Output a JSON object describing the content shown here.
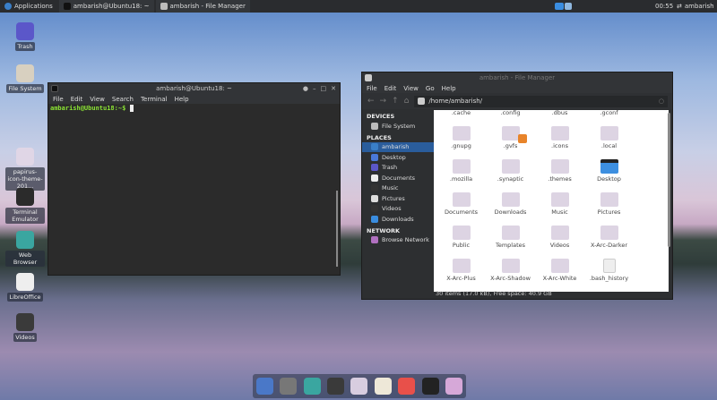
{
  "topbar": {
    "applications": "Applications",
    "windows": [
      "ambarish@Ubuntu18: ~",
      "ambarish - File Manager"
    ],
    "clock": "00:55",
    "user": "ambarish"
  },
  "desktop_icons": [
    {
      "label": "Trash",
      "color": "#5b57c9"
    },
    {
      "label": "File System",
      "color": "#d8d0c0"
    },
    {
      "label": "papirus-icon-theme-201...",
      "color": "#e0d6e6"
    },
    {
      "label": "Terminal Emulator",
      "color": "#2b2b2b"
    },
    {
      "label": "Web Browser",
      "color": "#3aa6a0"
    },
    {
      "label": "LibreOffice",
      "color": "#eeeeee"
    },
    {
      "label": "Videos",
      "color": "#3a3a3a"
    }
  ],
  "terminal": {
    "title": "ambarish@Ubuntu18: ~",
    "menu": [
      "File",
      "Edit",
      "View",
      "Search",
      "Terminal",
      "Help"
    ],
    "prompt": "ambarish@Ubuntu18:~$"
  },
  "file_manager": {
    "title": "ambarish - File Manager",
    "menu": [
      "File",
      "Edit",
      "View",
      "Go",
      "Help"
    ],
    "path": "/home/ambarish/",
    "sidebar": [
      {
        "header": "DEVICES",
        "items": [
          "File System"
        ]
      },
      {
        "header": "PLACES",
        "items": [
          "ambarish",
          "Desktop",
          "Trash",
          "Documents",
          "Music",
          "Pictures",
          "Videos",
          "Downloads"
        ]
      },
      {
        "header": "NETWORK",
        "items": [
          "Browse Network"
        ]
      }
    ],
    "selected": "ambarish",
    "files": [
      ".cache",
      ".config",
      ".dbus",
      ".gconf",
      ".gnupg",
      ".gvfs",
      ".icons",
      ".local",
      ".mozilla",
      ".synaptic",
      ".themes",
      "Desktop",
      "Documents",
      "Downloads",
      "Music",
      "Pictures",
      "Public",
      "Templates",
      "Videos",
      "X-Arc-Darker",
      "X-Arc-Plus",
      "X-Arc-Shadow",
      "X-Arc-White",
      ".bash_history"
    ],
    "status": "30 items (17.0 kB), Free space: 40.9 GB"
  },
  "dock": [
    {
      "name": "mail",
      "color": "#4a78c8"
    },
    {
      "name": "document",
      "color": "#777"
    },
    {
      "name": "web-browser",
      "color": "#3aa6a0"
    },
    {
      "name": "videos",
      "color": "#3a3a3a"
    },
    {
      "name": "home-folder",
      "color": "#d8cde0"
    },
    {
      "name": "music",
      "color": "#eee8d8"
    },
    {
      "name": "photos",
      "color": "#e8504a"
    },
    {
      "name": "terminal",
      "color": "#222"
    },
    {
      "name": "files",
      "color": "#d6a8d8"
    }
  ],
  "colors": {
    "accent": "#2a5d9c",
    "prompt": "#8ae234"
  }
}
